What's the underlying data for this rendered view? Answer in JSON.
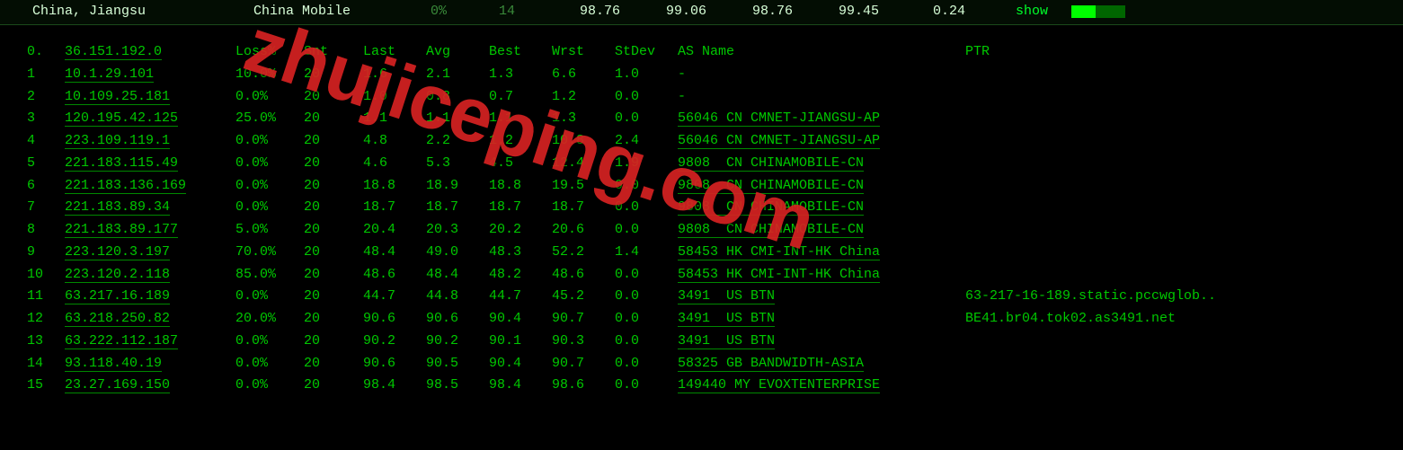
{
  "header": {
    "location": "China, Jiangsu",
    "provider": "China Mobile",
    "loss": "0%",
    "count": "14",
    "m1": "98.76",
    "m2": "99.06",
    "m3": "98.76",
    "m4": "99.45",
    "m5": "0.24",
    "show": "show"
  },
  "columns": {
    "hop": "0.",
    "ip": "36.151.192.0",
    "loss": "Loss%",
    "snt": "Snt",
    "last": "Last",
    "avg": "Avg",
    "best": "Best",
    "wrst": "Wrst",
    "stdv": "StDev",
    "asname": "AS Name",
    "ptr": "PTR"
  },
  "rows": [
    {
      "n": "1",
      "ip": "10.1.29.101",
      "loss": "10.0%",
      "snt": "20",
      "last": "1.6",
      "avg": "2.1",
      "best": "1.3",
      "wrst": "6.6",
      "stdv": "1.0",
      "as": "-",
      "ptr": ""
    },
    {
      "n": "2",
      "ip": "10.109.25.181",
      "loss": "0.0%",
      "snt": "20",
      "last": "1.0",
      "avg": "0.8",
      "best": "0.7",
      "wrst": "1.2",
      "stdv": "0.0",
      "as": "-",
      "ptr": ""
    },
    {
      "n": "3",
      "ip": "120.195.42.125",
      "loss": "25.0%",
      "snt": "20",
      "last": "1.1",
      "avg": "1.1",
      "best": "1.1",
      "wrst": "1.3",
      "stdv": "0.0",
      "as": "56046 CN CMNET-JIANGSU-AP",
      "ptr": ""
    },
    {
      "n": "4",
      "ip": "223.109.119.1",
      "loss": "0.0%",
      "snt": "20",
      "last": "4.8",
      "avg": "2.2",
      "best": "1.2",
      "wrst": "10.8",
      "stdv": "2.4",
      "as": "56046 CN CMNET-JIANGSU-AP",
      "ptr": ""
    },
    {
      "n": "5",
      "ip": "221.183.115.49",
      "loss": "0.0%",
      "snt": "20",
      "last": "4.6",
      "avg": "5.3",
      "best": "4.5",
      "wrst": "12.4",
      "stdv": "1.9",
      "as": "9808  CN CHINAMOBILE-CN",
      "ptr": ""
    },
    {
      "n": "6",
      "ip": "221.183.136.169",
      "loss": "0.0%",
      "snt": "20",
      "last": "18.8",
      "avg": "18.9",
      "best": "18.8",
      "wrst": "19.5",
      "stdv": "0.0",
      "as": "9808  CN CHINAMOBILE-CN",
      "ptr": ""
    },
    {
      "n": "7",
      "ip": "221.183.89.34",
      "loss": "0.0%",
      "snt": "20",
      "last": "18.7",
      "avg": "18.7",
      "best": "18.7",
      "wrst": "18.7",
      "stdv": "0.0",
      "as": "9808  CN CHINAMOBILE-CN",
      "ptr": ""
    },
    {
      "n": "8",
      "ip": "221.183.89.177",
      "loss": "5.0%",
      "snt": "20",
      "last": "20.4",
      "avg": "20.3",
      "best": "20.2",
      "wrst": "20.6",
      "stdv": "0.0",
      "as": "9808  CN CHINAMOBILE-CN",
      "ptr": ""
    },
    {
      "n": "9",
      "ip": "223.120.3.197",
      "loss": "70.0%",
      "snt": "20",
      "last": "48.4",
      "avg": "49.0",
      "best": "48.3",
      "wrst": "52.2",
      "stdv": "1.4",
      "as": "58453 HK CMI-INT-HK China",
      "ptr": ""
    },
    {
      "n": "10",
      "ip": "223.120.2.118",
      "loss": "85.0%",
      "snt": "20",
      "last": "48.6",
      "avg": "48.4",
      "best": "48.2",
      "wrst": "48.6",
      "stdv": "0.0",
      "as": "58453 HK CMI-INT-HK China",
      "ptr": ""
    },
    {
      "n": "11",
      "ip": "63.217.16.189",
      "loss": "0.0%",
      "snt": "20",
      "last": "44.7",
      "avg": "44.8",
      "best": "44.7",
      "wrst": "45.2",
      "stdv": "0.0",
      "as": "3491  US BTN",
      "ptr": "63-217-16-189.static.pccwglob.."
    },
    {
      "n": "12",
      "ip": "63.218.250.82",
      "loss": "20.0%",
      "snt": "20",
      "last": "90.6",
      "avg": "90.6",
      "best": "90.4",
      "wrst": "90.7",
      "stdv": "0.0",
      "as": "3491  US BTN",
      "ptr": "BE41.br04.tok02.as3491.net"
    },
    {
      "n": "13",
      "ip": "63.222.112.187",
      "loss": "0.0%",
      "snt": "20",
      "last": "90.2",
      "avg": "90.2",
      "best": "90.1",
      "wrst": "90.3",
      "stdv": "0.0",
      "as": "3491  US BTN",
      "ptr": ""
    },
    {
      "n": "14",
      "ip": "93.118.40.19",
      "loss": "0.0%",
      "snt": "20",
      "last": "90.6",
      "avg": "90.5",
      "best": "90.4",
      "wrst": "90.7",
      "stdv": "0.0",
      "as": "58325 GB BANDWIDTH-ASIA",
      "ptr": ""
    },
    {
      "n": "15",
      "ip": "23.27.169.150",
      "loss": "0.0%",
      "snt": "20",
      "last": "98.4",
      "avg": "98.5",
      "best": "98.4",
      "wrst": "98.6",
      "stdv": "0.0",
      "as": "149440 MY EVOXTENTERPRISE",
      "ptr": ""
    }
  ],
  "watermark": "zhujiceping.com"
}
